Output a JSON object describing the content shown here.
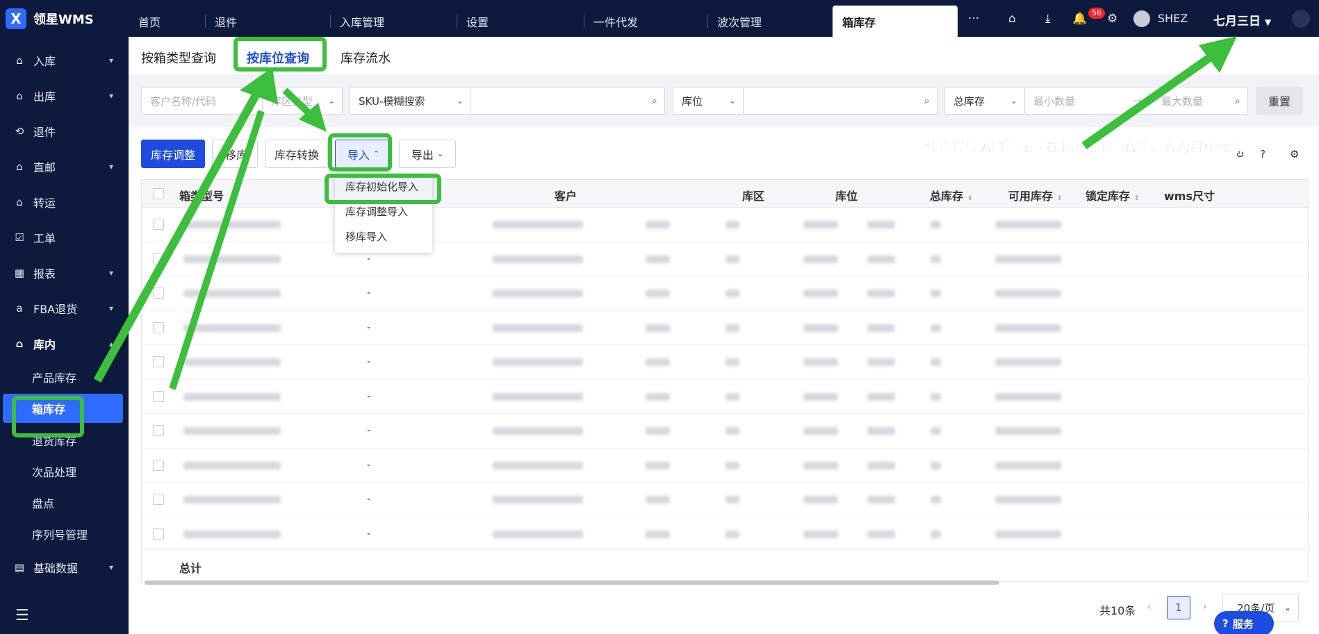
{
  "app": {
    "logo_text": "领星WMS"
  },
  "sidebar": {
    "items": [
      {
        "label": "入库",
        "icon": "inbound-icon",
        "chevron": true
      },
      {
        "label": "出库",
        "icon": "outbound-icon",
        "chevron": true
      },
      {
        "label": "退件",
        "icon": "return-icon",
        "chevron": false
      },
      {
        "label": "直邮",
        "icon": "direct-mail-icon",
        "chevron": true
      },
      {
        "label": "转运",
        "icon": "transship-icon",
        "chevron": false
      },
      {
        "label": "工单",
        "icon": "work-order-icon",
        "chevron": false
      },
      {
        "label": "报表",
        "icon": "report-icon",
        "chevron": true
      },
      {
        "label": "FBA退货",
        "icon": "amazon-icon",
        "chevron": true
      },
      {
        "label": "库内",
        "icon": "warehouse-icon",
        "chevron": true,
        "open": true
      }
    ],
    "sub_items": [
      "产品库存",
      "箱库存",
      "退货库存",
      "次品处理",
      "盘点",
      "序列号管理"
    ],
    "active_sub": "箱库存",
    "bottom_item": {
      "label": "基础数据",
      "icon": "base-data-icon"
    }
  },
  "topbar": {
    "tabs": [
      "首页",
      "退件",
      "入库管理",
      "设置",
      "一件代发",
      "波次管理",
      "箱库存"
    ],
    "active_tab": "箱库存",
    "more": "···",
    "notification_count": "56",
    "user_name": "SHEZ",
    "warehouse": "七月三日"
  },
  "subtabs": [
    "按箱类型查询",
    "按库位查询",
    "库存流水"
  ],
  "active_subtab": "按库位查询",
  "filters": {
    "customer_placeholder": "客户名称/代码",
    "area_type_placeholder": "库区类型",
    "sku_select": "SKU-模糊搜索",
    "location_select": "库位",
    "stock_select": "总库存",
    "min_placeholder": "最小数量",
    "max_placeholder": "最大数量",
    "reset": "重置"
  },
  "toolbar": {
    "adjust": "库存调整",
    "move": "移库",
    "convert": "库存转换",
    "import": "导入",
    "export": "导出"
  },
  "import_menu": [
    "库存初始化导入",
    "库存调整导入",
    "移库导入"
  ],
  "table": {
    "columns": [
      "箱类型号",
      "客户",
      "库区",
      "库位",
      "总库存",
      "可用库存",
      "锁定库存",
      "wms尺寸"
    ],
    "dash_values": [
      "-",
      "-",
      "-",
      "-",
      "-",
      "-",
      "-",
      "-",
      "-"
    ],
    "total_label": "总计"
  },
  "pagination": {
    "total": "共10条",
    "page": "1",
    "page_size": "20条/页"
  },
  "service": "服务",
  "annotation": {
    "note": "操作库存导入时请注意右上角显示的仓库是否为目标仓库",
    "color": "#3cbf3c"
  }
}
